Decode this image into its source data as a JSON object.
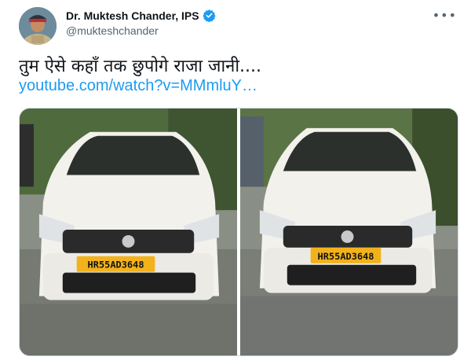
{
  "tweet": {
    "author_name": "Dr. Muktesh Chander, IPS",
    "handle": "@mukteshchander",
    "more_icon": "more-horizontal-icon",
    "verified_icon": "verified-badge-icon",
    "text": "तुम ऐसे कहाँ तक छुपोगे राजा जानी....",
    "link": "youtube.com/watch?v=MMmluY…"
  },
  "media": {
    "photos": [
      {
        "plate": "HR55AD3648"
      },
      {
        "plate": "HR55AD3648"
      }
    ]
  },
  "colors": {
    "link": "#1d9bf0",
    "verified": "#1d9bf0",
    "plate": "#f2b21b",
    "car_body": "#f2f1ec"
  }
}
